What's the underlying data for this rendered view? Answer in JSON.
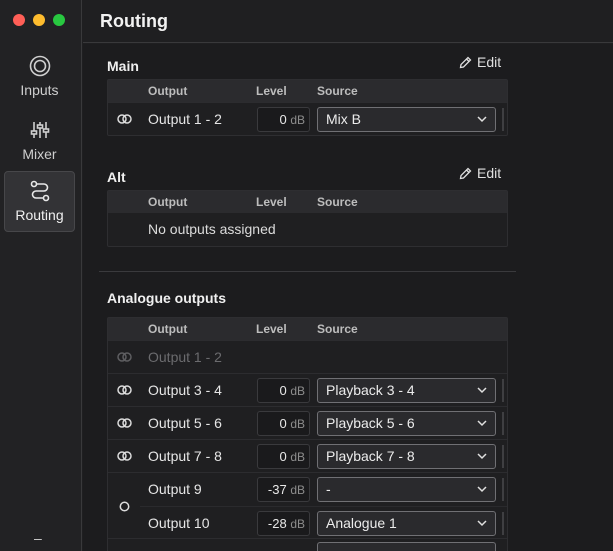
{
  "app": {
    "title": "Routing"
  },
  "nav": {
    "items": [
      {
        "label": "Inputs"
      },
      {
        "label": "Mixer"
      },
      {
        "label": "Routing"
      }
    ],
    "footer": "–"
  },
  "columns": {
    "output": "Output",
    "level": "Level",
    "source": "Source"
  },
  "main": {
    "title": "Main",
    "edit": "Edit",
    "rows": [
      {
        "output": "Output 1 - 2",
        "level": "0",
        "unit": "dB",
        "source": "Mix B"
      }
    ]
  },
  "alt": {
    "title": "Alt",
    "edit": "Edit",
    "empty": "No outputs assigned"
  },
  "analogue": {
    "title": "Analogue outputs",
    "rows": [
      {
        "output": "Output 1 - 2"
      },
      {
        "output": "Output 3 - 4",
        "level": "0",
        "unit": "dB",
        "source": "Playback 3 - 4"
      },
      {
        "output": "Output 5 - 6",
        "level": "0",
        "unit": "dB",
        "source": "Playback 5 - 6"
      },
      {
        "output": "Output 7 - 8",
        "level": "0",
        "unit": "dB",
        "source": "Playback 7 - 8"
      },
      {
        "output": "Output 9",
        "level": "-37",
        "unit": "dB",
        "source": "-"
      },
      {
        "output": "Output 10",
        "level": "-28",
        "unit": "dB",
        "source": "Analogue 1"
      }
    ]
  },
  "colors": {
    "close": "#ff5f57",
    "minimize": "#febc2e",
    "zoom": "#28c840"
  }
}
